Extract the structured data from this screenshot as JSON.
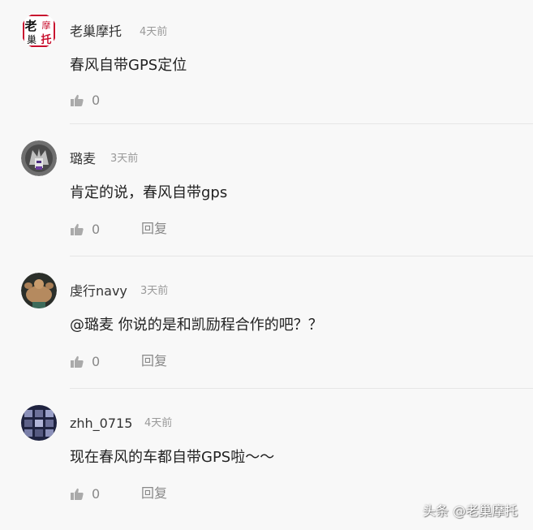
{
  "comments": [
    {
      "username": "老巢摩托",
      "time": "4天前",
      "content": "春风自带GPS定位",
      "likes": "0",
      "reply_label": "",
      "avatar_text": "老摩巢托"
    },
    {
      "username": "璐麦",
      "time": "3天前",
      "content": "肯定的说，春风自带gps",
      "likes": "0",
      "reply_label": "回复"
    },
    {
      "username": "虔行navy",
      "time": "3天前",
      "content": "@璐麦 你说的是和凯励程合作的吧？？",
      "likes": "0",
      "reply_label": "回复"
    },
    {
      "username": "zhh_0715",
      "time": "4天前",
      "content": "现在春风的车都自带GPS啦～～",
      "likes": "0",
      "reply_label": "回复"
    }
  ],
  "watermark": "头条 @老巢摩托",
  "icons": {
    "like": "thumbs-up-icon"
  },
  "colors": {
    "background": "#f8f8f8",
    "text": "#222222",
    "muted": "#999999",
    "icon": "#aaaaaa"
  }
}
